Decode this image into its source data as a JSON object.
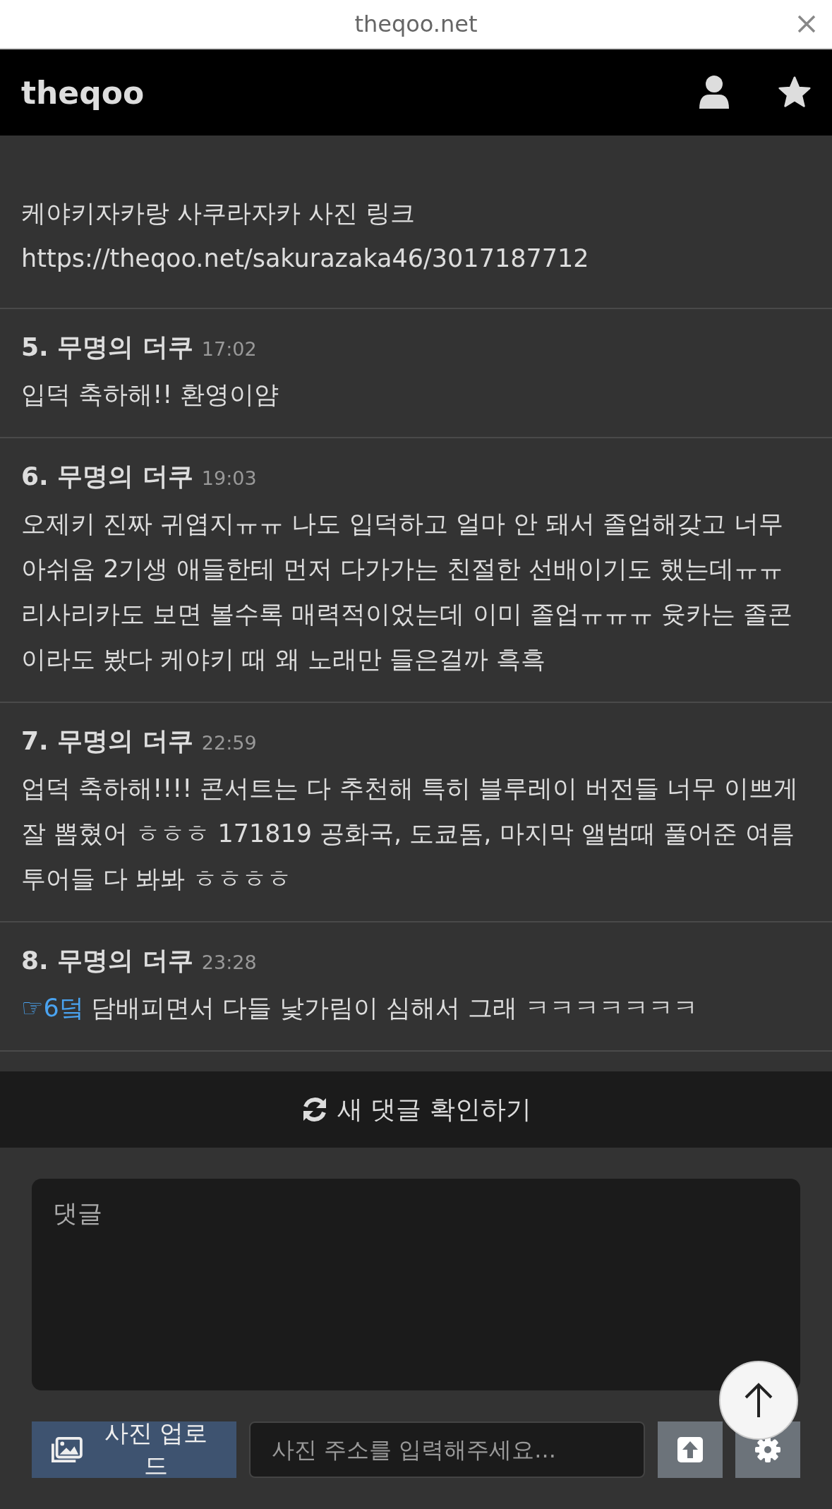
{
  "browser_bar": {
    "url": "theqoo.net"
  },
  "header": {
    "logo": "theqoo"
  },
  "post_tail": {
    "lines": [
      "케야키자카랑 사쿠라자카 사진 링크",
      "https://theqoo.net/sakurazaka46/3017187712"
    ]
  },
  "comments": [
    {
      "author": "5. 무명의 더쿠",
      "time": "17:02",
      "text": "입덕 축하해!! 환영이얌"
    },
    {
      "author": "6. 무명의 더쿠",
      "time": "19:03",
      "text": "오제키 진짜 귀엽지ㅠㅠ 나도 입덕하고 얼마 안 돼서 졸업해갖고 너무 아쉬움 2기생 애들한테 먼저 다가가는 친절한 선배이기도 했는데ㅠㅠ 리사리카도 보면 볼수록 매력적이었는데 이미 졸업ㅠㅠㅠ 윳카는 졸콘이라도 봤다 케야키 때 왜 노래만 들은걸까 흑흑"
    },
    {
      "author": "7. 무명의 더쿠",
      "time": "22:59",
      "text": "업덕 축하해!!!! 콘서트는 다 추천해 특히 블루레이 버전들 너무 이쁘게 잘 뽑혔어 ㅎㅎㅎ 171819 공화국, 도쿄돔, 마지막 앨범때 풀어준 여름 투어들 다 봐봐 ㅎㅎㅎㅎ"
    },
    {
      "author": "8. 무명의 더쿠",
      "time": "23:28",
      "reply_link": "☞6덬",
      "text": "담배피면서 다들 낯가림이 심해서 그래 ㅋㅋㅋㅋㅋㅋㅋ"
    }
  ],
  "refresh_button": {
    "label": "새 댓글 확인하기"
  },
  "comment_form": {
    "placeholder": "댓글",
    "upload_button": "사진 업로드",
    "url_placeholder": "사진 주소를 입력해주세요..."
  }
}
